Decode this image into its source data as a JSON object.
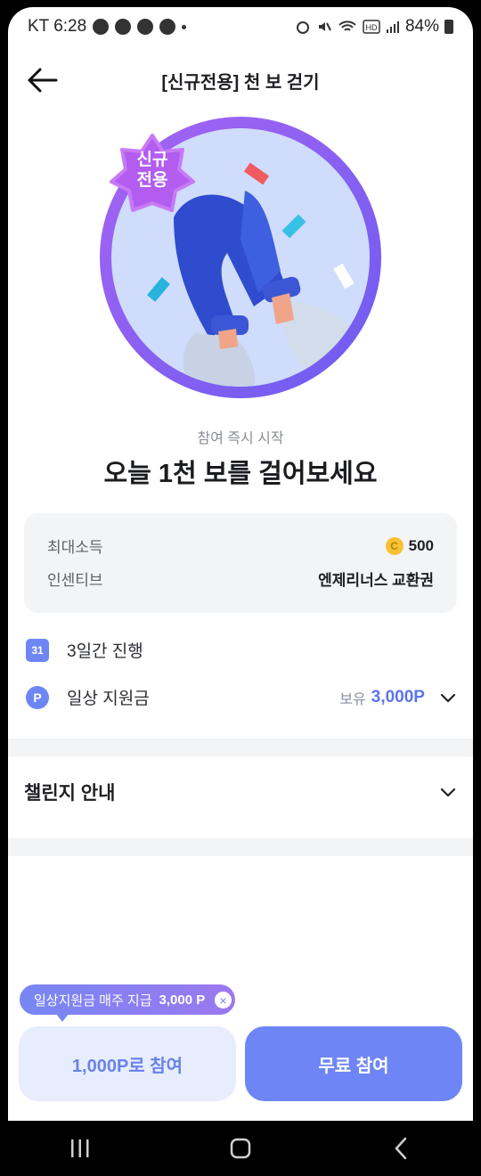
{
  "status_bar": {
    "carrier_time": "KT 6:28",
    "battery": "84%",
    "icons": [
      "kakaotalk-icon",
      "message-icon",
      "chat-icon",
      "alarm-icon",
      "mute-icon",
      "wifi-icon",
      "hd-icon",
      "signal-icon",
      "battery-icon"
    ]
  },
  "header": {
    "title": "[신규전용] 천 보 걷기",
    "back_icon": "arrow-left-icon"
  },
  "hero": {
    "badge_line1": "신규",
    "badge_line2": "전용"
  },
  "intro": {
    "subtitle": "참여 즉시 시작",
    "title": "오늘 1천 보를 걸어보세요"
  },
  "info_card": {
    "max_income_label": "최대소득",
    "max_income_coin": "C",
    "max_income_value": "500",
    "incentive_label": "인센티브",
    "incentive_value": "엔제리너스 교환권"
  },
  "duration": {
    "calendar_day": "31",
    "label": "3일간 진행"
  },
  "support": {
    "p_icon": "P",
    "label": "일상 지원금",
    "hold_label": "보유",
    "hold_amount": "3,000P"
  },
  "guide": {
    "label": "챌린지 안내"
  },
  "tooltip": {
    "text": "일상지원금 매주 지급",
    "points": "3,000 P",
    "close": "×"
  },
  "buttons": {
    "paid": "1,000P로 참여",
    "free": "무료 참여"
  },
  "colors": {
    "primary": "#6e86f5",
    "primary_light": "#e7edfd",
    "card_bg": "#f3f4f6"
  }
}
